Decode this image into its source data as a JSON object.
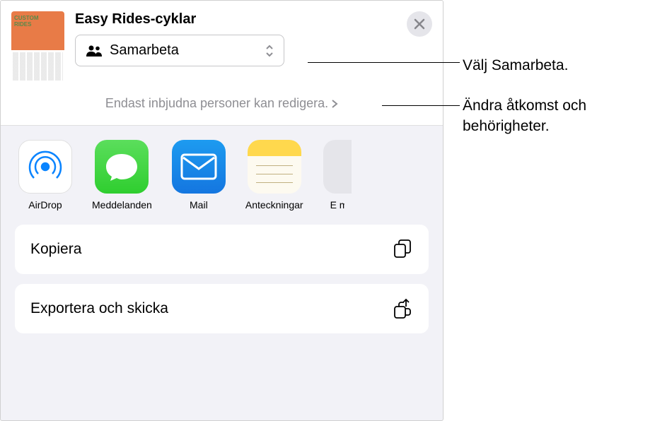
{
  "header": {
    "title": "Easy Rides-cyklar",
    "dropdown_label": "Samarbeta",
    "subtitle": "Endast inbjudna personer kan redigera."
  },
  "apps": [
    {
      "label": "AirDrop",
      "icon": "airdrop"
    },
    {
      "label": "Meddelanden",
      "icon": "messages"
    },
    {
      "label": "Mail",
      "icon": "mail"
    },
    {
      "label": "Anteckningar",
      "icon": "notes"
    }
  ],
  "more_app_label": "E m",
  "actions": [
    {
      "label": "Kopiera",
      "icon": "copy"
    },
    {
      "label": "Exportera och skicka",
      "icon": "export"
    }
  ],
  "annotations": {
    "a1": "Välj Samarbeta.",
    "a2": "Ändra åtkomst och behörigheter."
  }
}
